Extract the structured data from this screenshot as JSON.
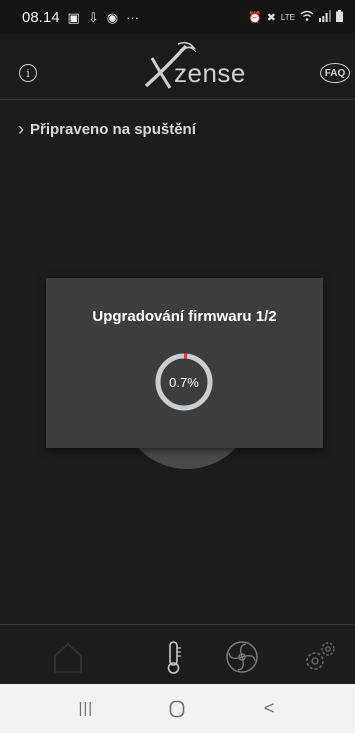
{
  "status_bar": {
    "time": "08.14",
    "dots": "···",
    "icons_left": [
      "image-icon",
      "download-icon",
      "facebook-icon"
    ],
    "icons_right": [
      "alarm-icon",
      "mute-icon",
      "volte-icon",
      "wifi-icon",
      "signal-icon",
      "battery-icon"
    ]
  },
  "header": {
    "logo_text": "zense",
    "logo_letter": "X",
    "info_glyph": "i",
    "faq_label": "FAQ"
  },
  "main": {
    "status_text": "Připraveno na spuštění"
  },
  "modal": {
    "title": "Upgradování firmwaru 1/2",
    "progress_label": "0.7%",
    "progress_fraction": 0.007,
    "ring_color": "#c9cfd2",
    "progress_color": "#e53935"
  },
  "bottom_nav": {
    "items": [
      "home-icon",
      "thermometer-icon",
      "fan-icon",
      "settings-icon"
    ]
  },
  "android_nav": {
    "recents": "|||",
    "home": "○",
    "back": "<"
  }
}
